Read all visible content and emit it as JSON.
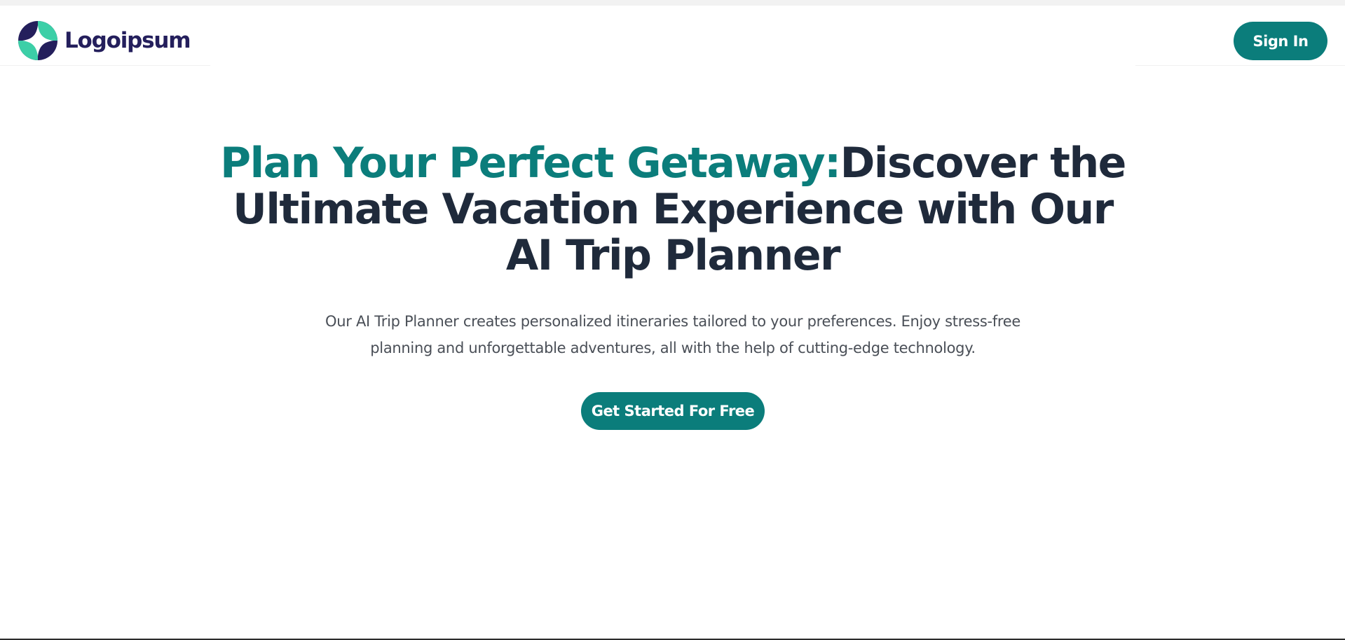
{
  "header": {
    "logo": {
      "text": "Logoipsum",
      "icon": "logo-mark-icon",
      "colors": {
        "teal": "#3ccfa7",
        "navy": "#241f5c"
      }
    },
    "signin_label": "Sign In"
  },
  "hero": {
    "title_accent": "Plan Your Perfect Getaway:",
    "title_rest": "Discover the Ultimate Vacation Experience with Our AI Trip Planner",
    "subtitle": "Our AI Trip Planner creates personalized itineraries tailored to your preferences. Enjoy stress-free planning and unforgettable adventures, all with the help of cutting-edge technology.",
    "cta_label": "Get Started For Free"
  },
  "colors": {
    "accent": "#0b7d7b",
    "heading": "#1f2a3b",
    "body_text": "#4a4f57",
    "background": "#ffffff"
  }
}
